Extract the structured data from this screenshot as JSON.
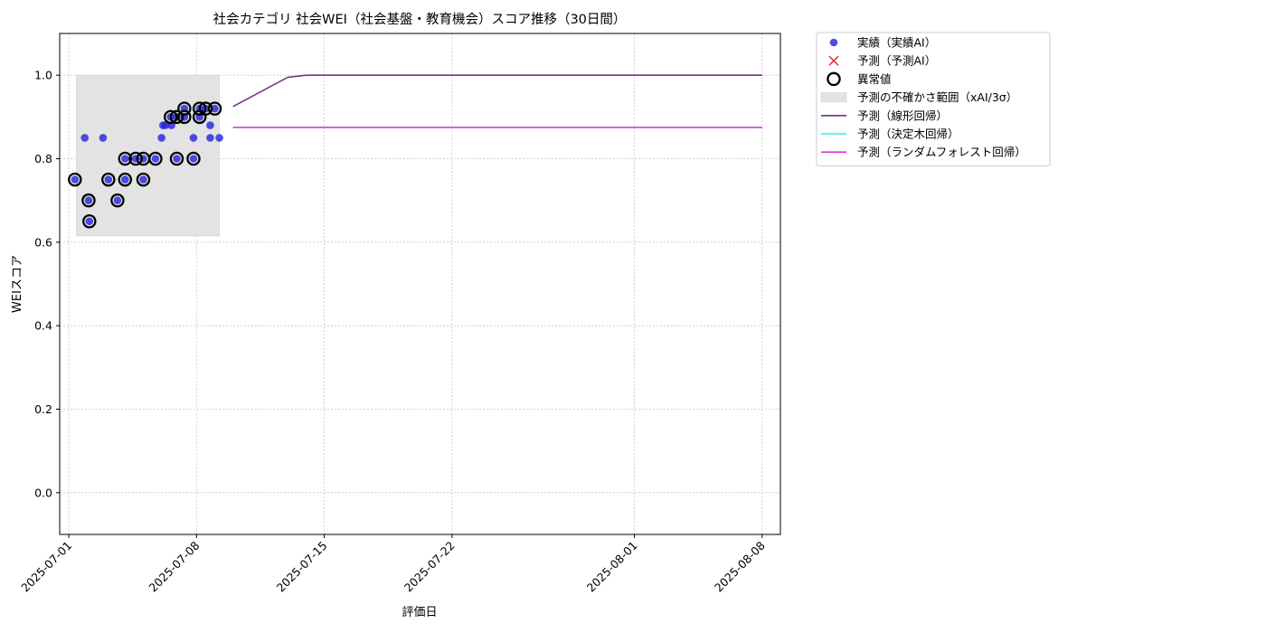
{
  "chart_data": {
    "type": "scatter",
    "title": "社会カテゴリ 社会WEI（社会基盤・教育機会）スコア推移（30日間）",
    "xlabel": "評価日",
    "ylabel": "WEIスコア",
    "x_range": [
      "2025-06-30T12:00",
      "2025-08-09T00:00"
    ],
    "ylim": [
      -0.1,
      1.1
    ],
    "x_ticks": [
      "2025-07-01",
      "2025-07-08",
      "2025-07-15",
      "2025-07-22",
      "2025-08-01",
      "2025-08-08"
    ],
    "y_ticks": [
      "0.0",
      "0.2",
      "0.4",
      "0.6",
      "0.8",
      "1.0"
    ],
    "grid": true,
    "legend_position": "outside-top-right",
    "uncertainty_band": {
      "x_start": "2025-07-01T10:00",
      "x_end": "2025-07-09T06:00",
      "y_low": 0.615,
      "y_high": 1.0,
      "color": "#e3e3e3"
    },
    "series": [
      {
        "name": "実績（実績AI）",
        "kind": "scatter",
        "color": "#2222dd",
        "points": [
          [
            "2025-07-01T08:00",
            0.75
          ],
          [
            "2025-07-01T21:00",
            0.85
          ],
          [
            "2025-07-02T02:00",
            0.7
          ],
          [
            "2025-07-02T03:00",
            0.65
          ],
          [
            "2025-07-02T21:00",
            0.85
          ],
          [
            "2025-07-03T04:00",
            0.75
          ],
          [
            "2025-07-03T16:00",
            0.7
          ],
          [
            "2025-07-04T02:00",
            0.8
          ],
          [
            "2025-07-04T02:00",
            0.75
          ],
          [
            "2025-07-04T16:00",
            0.8
          ],
          [
            "2025-07-05T02:00",
            0.8
          ],
          [
            "2025-07-05T02:00",
            0.75
          ],
          [
            "2025-07-05T18:00",
            0.8
          ],
          [
            "2025-07-06T02:00",
            0.85
          ],
          [
            "2025-07-06T04:00",
            0.88
          ],
          [
            "2025-07-06T07:00",
            0.88
          ],
          [
            "2025-07-06T14:00",
            0.9
          ],
          [
            "2025-07-06T15:00",
            0.88
          ],
          [
            "2025-07-06T22:00",
            0.9
          ],
          [
            "2025-07-06T22:00",
            0.8
          ],
          [
            "2025-07-07T08:00",
            0.92
          ],
          [
            "2025-07-07T08:00",
            0.9
          ],
          [
            "2025-07-07T20:00",
            0.85
          ],
          [
            "2025-07-07T20:00",
            0.8
          ],
          [
            "2025-07-08T04:00",
            0.92
          ],
          [
            "2025-07-08T04:00",
            0.9
          ],
          [
            "2025-07-08T12:00",
            0.92
          ],
          [
            "2025-07-08T18:00",
            0.88
          ],
          [
            "2025-07-08T18:00",
            0.85
          ],
          [
            "2025-07-09T00:00",
            0.92
          ],
          [
            "2025-07-09T06:00",
            0.85
          ]
        ]
      },
      {
        "name": "予測（予測AI）",
        "kind": "scatter-x",
        "color": "#ee3333",
        "points": []
      },
      {
        "name": "異常値",
        "kind": "ring",
        "color": "#000000",
        "points": [
          [
            "2025-07-01T08:00",
            0.75
          ],
          [
            "2025-07-02T02:00",
            0.7
          ],
          [
            "2025-07-02T03:00",
            0.65
          ],
          [
            "2025-07-03T04:00",
            0.75
          ],
          [
            "2025-07-03T16:00",
            0.7
          ],
          [
            "2025-07-04T02:00",
            0.8
          ],
          [
            "2025-07-04T02:00",
            0.75
          ],
          [
            "2025-07-04T16:00",
            0.8
          ],
          [
            "2025-07-05T02:00",
            0.8
          ],
          [
            "2025-07-05T02:00",
            0.75
          ],
          [
            "2025-07-05T18:00",
            0.8
          ],
          [
            "2025-07-06T14:00",
            0.9
          ],
          [
            "2025-07-06T22:00",
            0.9
          ],
          [
            "2025-07-06T22:00",
            0.8
          ],
          [
            "2025-07-07T08:00",
            0.92
          ],
          [
            "2025-07-07T08:00",
            0.9
          ],
          [
            "2025-07-07T20:00",
            0.8
          ],
          [
            "2025-07-08T04:00",
            0.92
          ],
          [
            "2025-07-08T04:00",
            0.9
          ],
          [
            "2025-07-08T12:00",
            0.92
          ],
          [
            "2025-07-09T00:00",
            0.92
          ]
        ]
      },
      {
        "name": "予測の不確かさ範囲（xAI/3σ）",
        "kind": "band",
        "color": "#e3e3e3"
      },
      {
        "name": "予測（線形回帰）",
        "kind": "line",
        "color": "#7b2d8b",
        "points": [
          [
            "2025-07-10T00:00",
            0.925
          ],
          [
            "2025-07-13T00:00",
            0.995
          ],
          [
            "2025-07-14T00:00",
            1.0
          ],
          [
            "2025-08-08T00:00",
            1.0
          ]
        ]
      },
      {
        "name": "予測（決定木回帰）",
        "kind": "line",
        "color": "#33e8ff",
        "points": [
          [
            "2025-07-10T00:00",
            0.875
          ],
          [
            "2025-08-08T00:00",
            0.875
          ]
        ]
      },
      {
        "name": "予測（ランダムフォレスト回帰）",
        "kind": "line",
        "color": "#dd33dd",
        "points": [
          [
            "2025-07-10T00:00",
            0.875
          ],
          [
            "2025-08-08T00:00",
            0.875
          ]
        ]
      }
    ]
  }
}
